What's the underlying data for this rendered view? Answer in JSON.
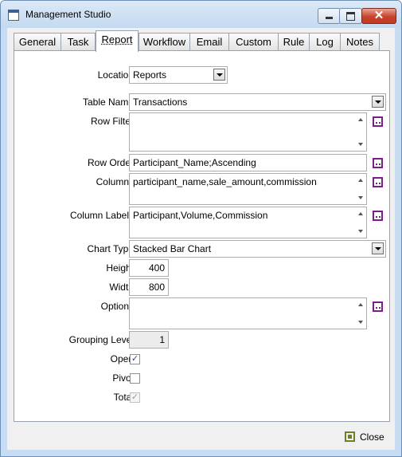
{
  "window": {
    "title": "Management Studio",
    "close_glyph": "✕"
  },
  "tabs": [
    {
      "label": "General"
    },
    {
      "label": "Task"
    },
    {
      "label": "Report"
    },
    {
      "label": "Workflow"
    },
    {
      "label": "Email"
    },
    {
      "label": "Custom"
    },
    {
      "label": "Rule"
    },
    {
      "label": "Log"
    },
    {
      "label": "Notes"
    }
  ],
  "active_tab": "Report",
  "form": {
    "location": {
      "label": "Location",
      "value": "Reports"
    },
    "table_name": {
      "label": "Table Name",
      "value": "Transactions"
    },
    "row_filter": {
      "label": "Row Filter",
      "value": ""
    },
    "row_order": {
      "label": "Row Order",
      "value": "Participant_Name;Ascending"
    },
    "columns": {
      "label": "Columns",
      "value": "participant_name,sale_amount,commission"
    },
    "column_labels": {
      "label": "Column Labels",
      "value": "Participant,Volume,Commission"
    },
    "chart_type": {
      "label": "Chart Type",
      "value": "Stacked Bar Chart"
    },
    "height": {
      "label": "Height",
      "value": "400"
    },
    "width": {
      "label": "Width",
      "value": "800"
    },
    "options": {
      "label": "Options",
      "value": ""
    },
    "grouping_level": {
      "label": "Grouping Level",
      "value": "1"
    },
    "open": {
      "label": "Open",
      "checked": true,
      "enabled": true
    },
    "pivot": {
      "label": "Pivot",
      "checked": false,
      "enabled": true
    },
    "total": {
      "label": "Total",
      "checked": true,
      "enabled": false
    }
  },
  "footer": {
    "close_label": "Close"
  },
  "icons": {
    "check_glyph": "✓",
    "footer_icons": [
      "new-icon",
      "help-icon",
      "list-icon"
    ],
    "help_glyph": "?"
  },
  "colors": {
    "ellipsis_button": "#7a1f8a",
    "close_icon": "#6f7f22",
    "titlebar": "#c7dcf2"
  }
}
